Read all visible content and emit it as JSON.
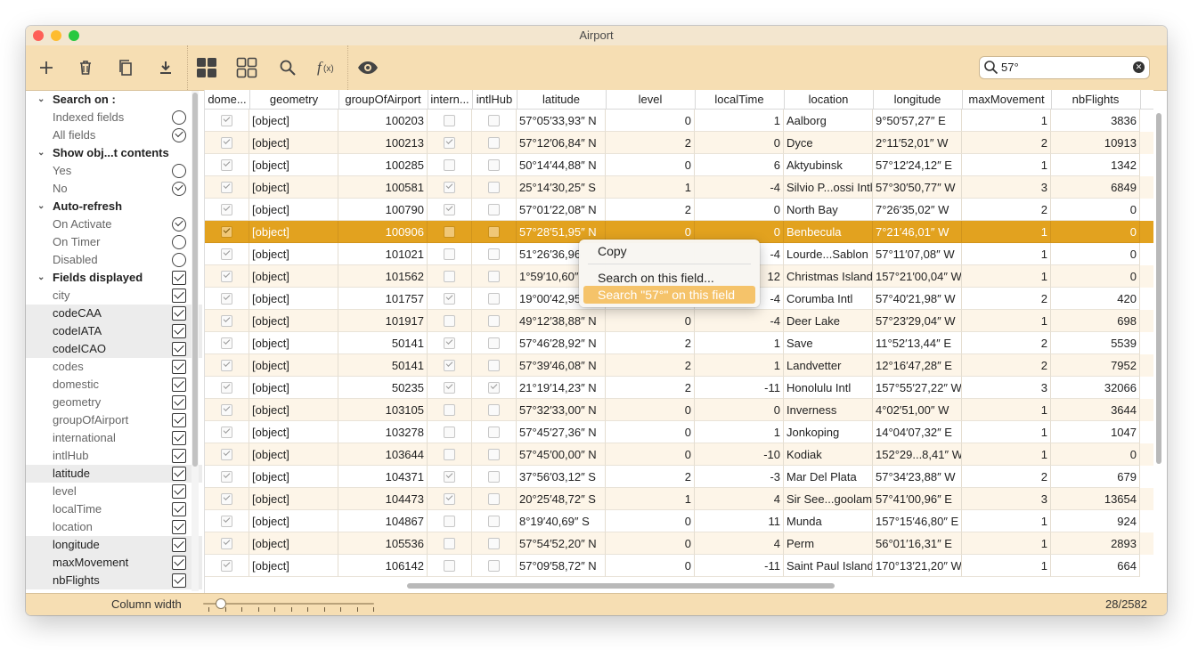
{
  "window": {
    "title": "Airport"
  },
  "toolbar": {
    "buttons": [
      {
        "name": "add-button",
        "icon": "plus-icon"
      },
      {
        "name": "delete-button",
        "icon": "trash-icon"
      },
      {
        "name": "duplicate-button",
        "icon": "copy-icon"
      },
      {
        "name": "download-button",
        "icon": "download-icon"
      },
      {
        "name": "grid-view-button",
        "icon": "grid-filled-icon"
      },
      {
        "name": "grid-outline-button",
        "icon": "grid-outline-icon"
      },
      {
        "name": "search-button",
        "icon": "search-icon"
      },
      {
        "name": "function-button",
        "icon": "function-icon",
        "label": "f(x)"
      },
      {
        "name": "preview-button",
        "icon": "eye-icon"
      }
    ],
    "search": {
      "value": "57°",
      "placeholder": ""
    }
  },
  "sidebar": {
    "sections": [
      {
        "title": "Search on :",
        "kind": "radio",
        "items": [
          {
            "label": "Indexed fields",
            "checked": false
          },
          {
            "label": "All fields",
            "checked": true
          }
        ]
      },
      {
        "title": "Show obj...t contents",
        "kind": "radio",
        "items": [
          {
            "label": "Yes",
            "checked": false
          },
          {
            "label": "No",
            "checked": true
          }
        ]
      },
      {
        "title": "Auto-refresh",
        "kind": "radio",
        "items": [
          {
            "label": "On Activate",
            "checked": true
          },
          {
            "label": "On Timer",
            "checked": false
          },
          {
            "label": "Disabled",
            "checked": false
          }
        ]
      },
      {
        "title": "Fields displayed",
        "kind": "check",
        "checked": true,
        "items": [
          {
            "label": "city",
            "checked": true,
            "hl": false
          },
          {
            "label": "codeCAA",
            "checked": true,
            "hl": true
          },
          {
            "label": "codeIATA",
            "checked": true,
            "hl": true
          },
          {
            "label": "codeICAO",
            "checked": true,
            "hl": true
          },
          {
            "label": "codes",
            "checked": true,
            "hl": false
          },
          {
            "label": "domestic",
            "checked": true,
            "hl": false
          },
          {
            "label": "geometry",
            "checked": true,
            "hl": false
          },
          {
            "label": "groupOfAirport",
            "checked": true,
            "hl": false
          },
          {
            "label": "international",
            "checked": true,
            "hl": false
          },
          {
            "label": "intlHub",
            "checked": true,
            "hl": false
          },
          {
            "label": "latitude",
            "checked": true,
            "hl": true
          },
          {
            "label": "level",
            "checked": true,
            "hl": false
          },
          {
            "label": "localTime",
            "checked": true,
            "hl": false
          },
          {
            "label": "location",
            "checked": true,
            "hl": false
          },
          {
            "label": "longitude",
            "checked": true,
            "hl": true
          },
          {
            "label": "maxMovement",
            "checked": true,
            "hl": true
          },
          {
            "label": "nbFlights",
            "checked": true,
            "hl": true
          }
        ]
      }
    ]
  },
  "table": {
    "columns": [
      "dome...",
      "geometry",
      "groupOfAirport",
      "intern...",
      "intlHub",
      "latitude",
      "level",
      "localTime",
      "location",
      "longitude",
      "maxMovement",
      "nbFlights"
    ],
    "rows": [
      {
        "dom": true,
        "geo": "[object]",
        "grp": "100203",
        "intl": false,
        "hub": false,
        "lat": "57°05′33,93″ N",
        "lvl": "0",
        "lt": "1",
        "loc": "Aalborg",
        "lon": "9°50′57,27″ E",
        "mm": "1",
        "nb": "3836"
      },
      {
        "dom": true,
        "geo": "[object]",
        "grp": "100213",
        "intl": true,
        "hub": false,
        "lat": "57°12′06,84″ N",
        "lvl": "2",
        "lt": "0",
        "loc": "Dyce",
        "lon": "2°11′52,01″ W",
        "mm": "2",
        "nb": "10913"
      },
      {
        "dom": true,
        "geo": "[object]",
        "grp": "100285",
        "intl": false,
        "hub": false,
        "lat": "50°14′44,88″ N",
        "lvl": "0",
        "lt": "6",
        "loc": "Aktyubinsk",
        "lon": "57°12′24,12″ E",
        "mm": "1",
        "nb": "1342"
      },
      {
        "dom": true,
        "geo": "[object]",
        "grp": "100581",
        "intl": true,
        "hub": false,
        "lat": "25°14′30,25″ S",
        "lvl": "1",
        "lt": "-4",
        "loc": "Silvio P...ossi Intl",
        "lon": "57°30′50,77″ W",
        "mm": "3",
        "nb": "6849"
      },
      {
        "dom": true,
        "geo": "[object]",
        "grp": "100790",
        "intl": true,
        "hub": false,
        "lat": "57°01′22,08″ N",
        "lvl": "2",
        "lt": "0",
        "loc": "North Bay",
        "lon": "7°26′35,02″ W",
        "mm": "2",
        "nb": "0"
      },
      {
        "dom": true,
        "geo": "[object]",
        "grp": "100906",
        "intl": false,
        "hub": false,
        "lat": "57°28′51,95″ N",
        "lvl": "0",
        "lt": "0",
        "loc": "Benbecula",
        "lon": "7°21′46,01″ W",
        "mm": "1",
        "nb": "0",
        "sel": true
      },
      {
        "dom": true,
        "geo": "[object]",
        "grp": "101021",
        "intl": false,
        "hub": false,
        "lat": "51°26′36,96",
        "lvl": "",
        "lt": "-4",
        "loc": "Lourde...Sablon",
        "lon": "57°11′07,08″ W",
        "mm": "1",
        "nb": "0"
      },
      {
        "dom": true,
        "geo": "[object]",
        "grp": "101562",
        "intl": false,
        "hub": false,
        "lat": "1°59′10,60″",
        "lvl": "",
        "lt": "12",
        "loc": "Christmas Island",
        "lon": "157°21′00,04″ W",
        "mm": "1",
        "nb": "0"
      },
      {
        "dom": true,
        "geo": "[object]",
        "grp": "101757",
        "intl": true,
        "hub": false,
        "lat": "19°00′42,95",
        "lvl": "",
        "lt": "-4",
        "loc": "Corumba Intl",
        "lon": "57°40′21,98″ W",
        "mm": "2",
        "nb": "420"
      },
      {
        "dom": true,
        "geo": "[object]",
        "grp": "101917",
        "intl": false,
        "hub": false,
        "lat": "49°12′38,88″ N",
        "lvl": "0",
        "lt": "-4",
        "loc": "Deer Lake",
        "lon": "57°23′29,04″ W",
        "mm": "1",
        "nb": "698"
      },
      {
        "dom": true,
        "geo": "[object]",
        "grp": "50141",
        "intl": true,
        "hub": false,
        "lat": "57°46′28,92″ N",
        "lvl": "2",
        "lt": "1",
        "loc": "Save",
        "lon": "11°52′13,44″ E",
        "mm": "2",
        "nb": "5539"
      },
      {
        "dom": true,
        "geo": "[object]",
        "grp": "50141",
        "intl": true,
        "hub": false,
        "lat": "57°39′46,08″ N",
        "lvl": "2",
        "lt": "1",
        "loc": "Landvetter",
        "lon": "12°16′47,28″ E",
        "mm": "2",
        "nb": "7952"
      },
      {
        "dom": true,
        "geo": "[object]",
        "grp": "50235",
        "intl": true,
        "hub": true,
        "lat": "21°19′14,23″ N",
        "lvl": "2",
        "lt": "-11",
        "loc": "Honolulu Intl",
        "lon": "157°55′27,22″ W",
        "mm": "3",
        "nb": "32066"
      },
      {
        "dom": true,
        "geo": "[object]",
        "grp": "103105",
        "intl": false,
        "hub": false,
        "lat": "57°32′33,00″ N",
        "lvl": "0",
        "lt": "0",
        "loc": "Inverness",
        "lon": "4°02′51,00″ W",
        "mm": "1",
        "nb": "3644"
      },
      {
        "dom": true,
        "geo": "[object]",
        "grp": "103278",
        "intl": false,
        "hub": false,
        "lat": "57°45′27,36″ N",
        "lvl": "0",
        "lt": "1",
        "loc": "Jonkoping",
        "lon": "14°04′07,32″ E",
        "mm": "1",
        "nb": "1047"
      },
      {
        "dom": true,
        "geo": "[object]",
        "grp": "103644",
        "intl": false,
        "hub": false,
        "lat": "57°45′00,00″ N",
        "lvl": "0",
        "lt": "-10",
        "loc": "Kodiak",
        "lon": "152°29...8,41″ W",
        "mm": "1",
        "nb": "0"
      },
      {
        "dom": true,
        "geo": "[object]",
        "grp": "104371",
        "intl": true,
        "hub": false,
        "lat": "37°56′03,12″ S",
        "lvl": "2",
        "lt": "-3",
        "loc": "Mar Del Plata",
        "lon": "57°34′23,88″ W",
        "mm": "2",
        "nb": "679"
      },
      {
        "dom": true,
        "geo": "[object]",
        "grp": "104473",
        "intl": true,
        "hub": false,
        "lat": "20°25′48,72″ S",
        "lvl": "1",
        "lt": "4",
        "loc": "Sir See...goolam",
        "lon": "57°41′00,96″ E",
        "mm": "3",
        "nb": "13654"
      },
      {
        "dom": true,
        "geo": "[object]",
        "grp": "104867",
        "intl": false,
        "hub": false,
        "lat": "8°19′40,69″ S",
        "lvl": "0",
        "lt": "11",
        "loc": "Munda",
        "lon": "157°15′46,80″ E",
        "mm": "1",
        "nb": "924"
      },
      {
        "dom": true,
        "geo": "[object]",
        "grp": "105536",
        "intl": false,
        "hub": false,
        "lat": "57°54′52,20″ N",
        "lvl": "0",
        "lt": "4",
        "loc": "Perm",
        "lon": "56°01′16,31″ E",
        "mm": "1",
        "nb": "2893"
      },
      {
        "dom": true,
        "geo": "[object]",
        "grp": "106142",
        "intl": false,
        "hub": false,
        "lat": "57°09′58,72″ N",
        "lvl": "0",
        "lt": "-11",
        "loc": "Saint Paul Island",
        "lon": "170°13′21,20″ W",
        "mm": "1",
        "nb": "664"
      }
    ]
  },
  "context_menu": {
    "copy": "Copy",
    "search_field": "Search on this field...",
    "search_value": "Search \"57°\" on this field"
  },
  "bottom": {
    "column_width_label": "Column width",
    "count": "28/2582",
    "slider_value": 0.1
  },
  "colors": {
    "toolbar": "#f6deb3",
    "selection": "#e2a21f",
    "alt_row": "#fdf5e8",
    "menu_highlight": "#f5c36a"
  }
}
